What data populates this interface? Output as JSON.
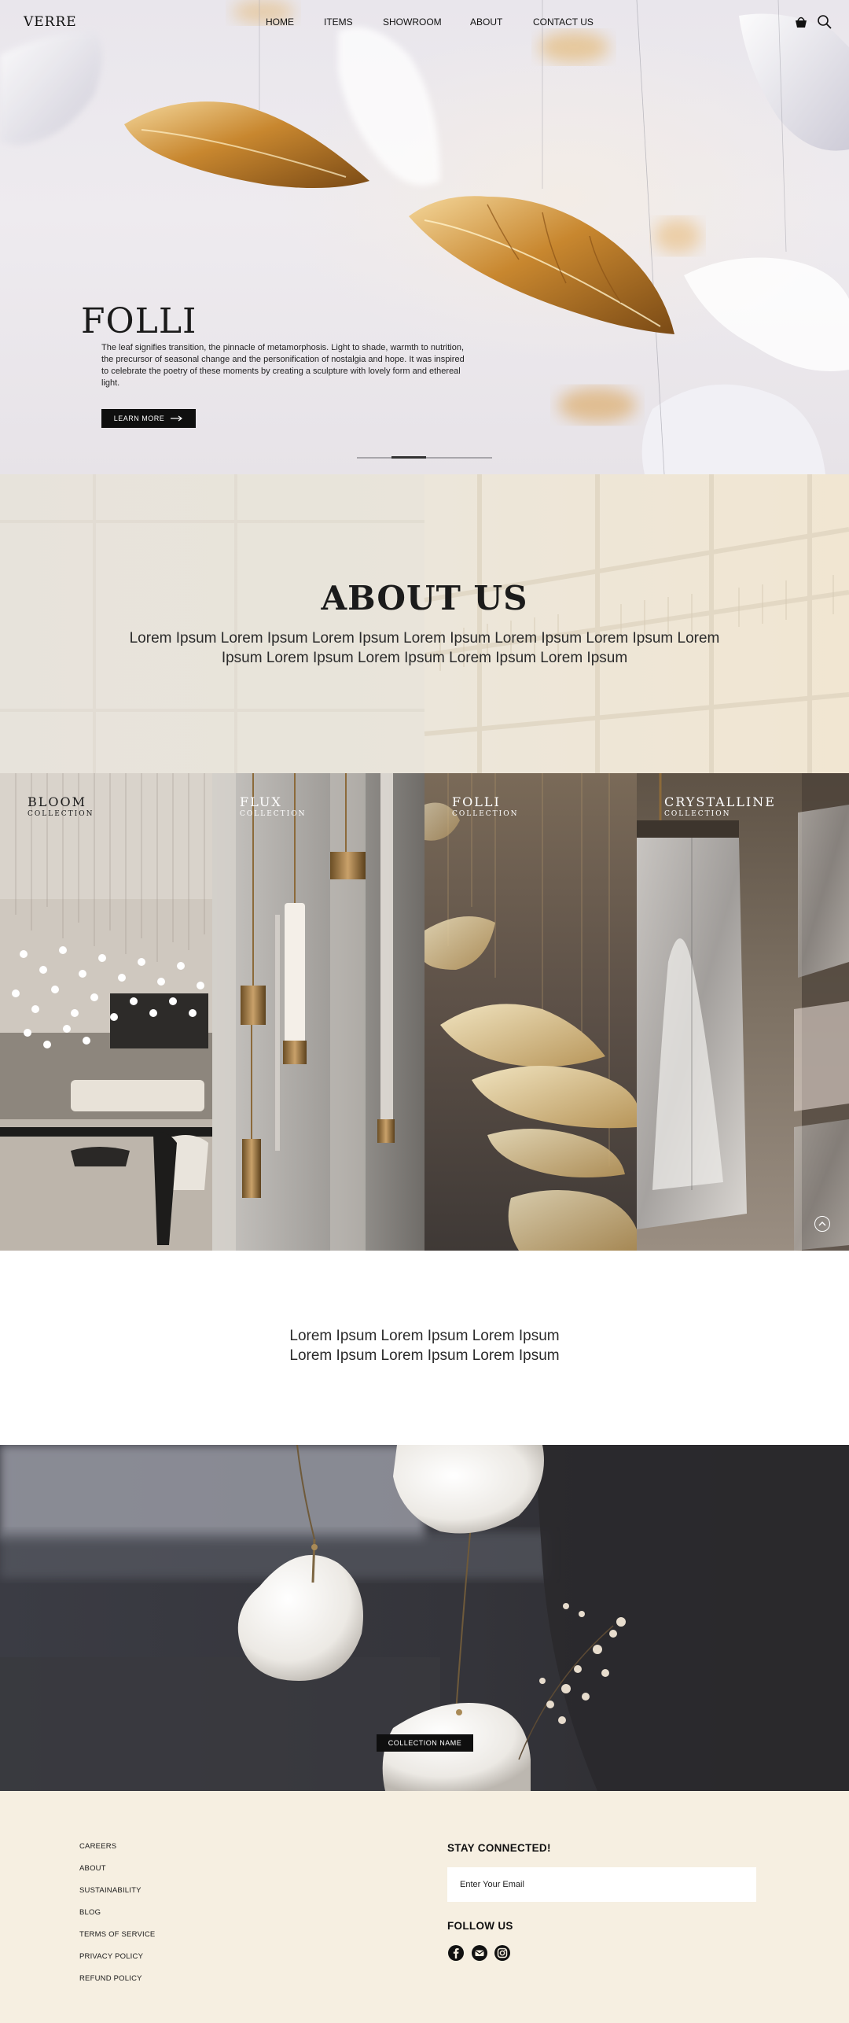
{
  "nav": {
    "logo": "VERRE",
    "links": [
      "HOME",
      "ITEMS",
      "SHOWROOM",
      "ABOUT",
      "CONTACT US"
    ],
    "icons": [
      "basket-icon",
      "search-icon"
    ]
  },
  "hero": {
    "title": "FOLLI",
    "description": "The leaf signifies transition, the pinnacle of metamorphosis. Light to shade, warmth to nutrition, the precursor of seasonal change and the personification of nostalgia and hope. It was inspired to celebrate the poetry of these moments by creating a sculpture with lovely form and ethereal light.",
    "button_label": "LEARN MORE",
    "slide_current": 2,
    "slide_total": 4
  },
  "about": {
    "title": "ABOUT US",
    "text": "Lorem Ipsum Lorem Ipsum Lorem Ipsum Lorem Ipsum Lorem Ipsum Lorem Ipsum Lorem Ipsum Lorem Ipsum Lorem Ipsum Lorem Ipsum Lorem Ipsum"
  },
  "collections": [
    {
      "name": "BLOOM",
      "subtitle": "COLLECTION"
    },
    {
      "name": "FLUX",
      "subtitle": "COLLECTION"
    },
    {
      "name": "FOLLI",
      "subtitle": "COLLECTION"
    },
    {
      "name": "CRYSTALLINE",
      "subtitle": "COLLECTION"
    }
  ],
  "tagline": {
    "line1": "Lorem Ipsum Lorem Ipsum Lorem Ipsum",
    "line2": "Lorem Ipsum Lorem Ipsum Lorem Ipsum"
  },
  "feature": {
    "button_label": "COLLECTION NAME"
  },
  "footer": {
    "links": [
      "CAREERS",
      "ABOUT",
      "SUSTAINABILITY",
      "BLOG",
      "TERMS OF SERVICE",
      "PRIVACY POLICY",
      "REFUND POLICY"
    ],
    "stay_connected": "STAY CONNECTED!",
    "email_placeholder": "Enter Your Email",
    "follow_us": "FOLLOW US",
    "social_icons": [
      "facebook-icon",
      "email-icon",
      "instagram-icon"
    ]
  },
  "colors": {
    "hero_bg": "#ebe8ed",
    "gold": "#c9913f",
    "about_bg": "#ece6da",
    "footer_bg": "#f6efe1",
    "button_bg": "#0f0f0f"
  }
}
